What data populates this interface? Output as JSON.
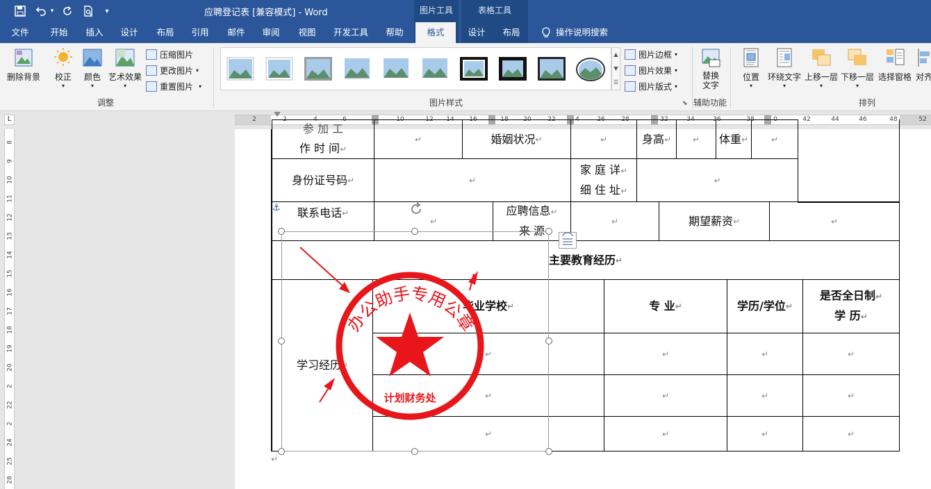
{
  "window": {
    "title": "应聘登记表 [兼容模式]  -  Word"
  },
  "contextual": {
    "picture_tools": "图片工具",
    "table_tools": "表格工具"
  },
  "tabs": {
    "file": "文件",
    "home": "开始",
    "insert": "插入",
    "design": "设计",
    "layout": "布局",
    "references": "引用",
    "mailings": "邮件",
    "review": "审阅",
    "view": "视图",
    "developer": "开发工具",
    "help": "帮助",
    "format": "格式",
    "table_design": "设计",
    "table_layout": "布局",
    "tell_me": "操作说明搜索"
  },
  "ribbon": {
    "adjust": {
      "remove_bg": "删除背景",
      "corrections": "校正",
      "color": "颜色",
      "artistic": "艺术效果",
      "compress": "压缩图片",
      "change": "更改图片",
      "reset": "重置图片",
      "label": "调整"
    },
    "styles": {
      "label": "图片样式",
      "border": "图片边框",
      "effects": "图片效果",
      "layout": "图片版式"
    },
    "accessibility": {
      "alt_text_1": "替换",
      "alt_text_2": "文字",
      "label": "辅助功能"
    },
    "arrange": {
      "position": "位置",
      "wrap": "环绕文字",
      "forward": "上移一层",
      "backward": "下移一层",
      "selection_pane": "选择窗格",
      "align": "对齐",
      "label": "排列"
    }
  },
  "ruler": {
    "h": [
      "2",
      "2",
      "4",
      "6",
      "10",
      "12",
      "14",
      "16",
      "18",
      "20",
      "22",
      "4",
      "26",
      "28",
      "32",
      "34",
      "36",
      "38",
      "0",
      "42",
      "44",
      "46",
      "48",
      "52"
    ],
    "v": [
      "8",
      "9",
      "10",
      "11",
      "12",
      "13",
      "14",
      "15",
      "16",
      "17",
      "18",
      "19",
      "20",
      "2",
      "22",
      "2",
      "24",
      "25",
      "28"
    ]
  },
  "table": {
    "join_work_1": "参 加 工",
    "join_work_2": "作 时 间",
    "marital": "婚姻状况",
    "height": "身高",
    "weight": "体重",
    "id_no": "身份证号码",
    "address_1": "家 庭 详",
    "address_2": "细 住 址",
    "phone": "联系电话",
    "source_1": "应聘信息",
    "source_2": "来      源",
    "salary": "期望薪资",
    "edu_header": "主要教育经历",
    "school": "毕业学校",
    "major": "专      业",
    "degree": "学历/学位",
    "fulltime_1": "是否全日制",
    "fulltime_2": "学      历",
    "study": "学习经历",
    "mark": "↵"
  },
  "seal": {
    "text": "办公助手专用公章",
    "bottom": "计划财务处",
    "color": "#e8151b"
  }
}
